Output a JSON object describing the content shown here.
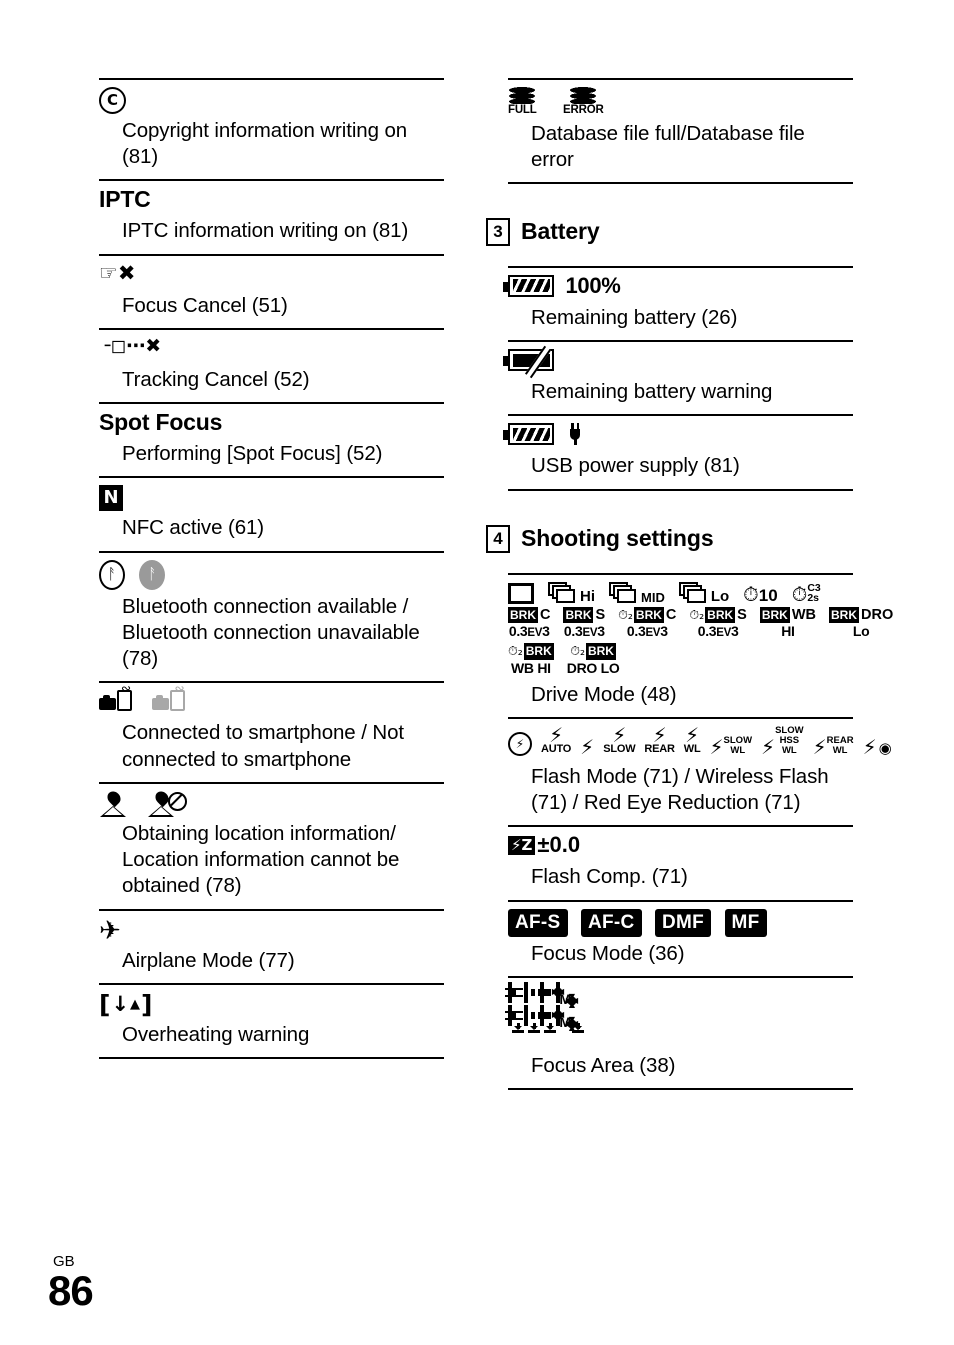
{
  "page": {
    "language_code": "GB",
    "page_number": "86"
  },
  "left_column": {
    "entries": [
      {
        "symbol_kind": "copyright-circle",
        "symbol_text": "C",
        "description": "Copyright information writing on (81)"
      },
      {
        "symbol_kind": "word",
        "symbol_text": "IPTC",
        "description": "IPTC information writing on (81)"
      },
      {
        "symbol_kind": "hand-cancel",
        "symbol_text": "☛✕",
        "description": "Focus Cancel (51)"
      },
      {
        "symbol_kind": "tracking-cancel",
        "symbol_text": "l▢⋟✕",
        "description": "Tracking Cancel (52)"
      },
      {
        "symbol_kind": "word",
        "symbol_text": "Spot Focus",
        "description": "Performing [Spot Focus] (52)"
      },
      {
        "symbol_kind": "nfc",
        "symbol_text": "N",
        "description": "NFC active (61)"
      },
      {
        "symbol_kind": "bluetooth-pair",
        "symbol_text": "ᛒ ᛒ",
        "description": "Bluetooth connection available / Bluetooth connection unavailable (78)"
      },
      {
        "symbol_kind": "smartphone-pair",
        "symbol_text": "camera-phone",
        "description": "Connected to smartphone / Not connected to smartphone"
      },
      {
        "symbol_kind": "location-pair",
        "symbol_text": "location-pin",
        "description": "Obtaining location information/ Location information cannot be obtained (78)"
      },
      {
        "symbol_kind": "airplane",
        "symbol_text": "✈",
        "description": "Airplane Mode (77)"
      },
      {
        "symbol_kind": "overheat",
        "symbol_text": "[!▲]",
        "description": "Overheating warning"
      }
    ]
  },
  "right_column": {
    "database_entry": {
      "symbol_kind": "database-stack",
      "label_full": "FULL",
      "label_error": "ERROR",
      "description": "Database file full/Database file error"
    },
    "sections": [
      {
        "number": "3",
        "title": "Battery",
        "entries": [
          {
            "symbol_kind": "battery-full",
            "symbol_text": "100%",
            "description": "Remaining battery (26)"
          },
          {
            "symbol_kind": "battery-warning",
            "symbol_text": "",
            "description": "Remaining battery warning"
          },
          {
            "symbol_kind": "battery-usb",
            "symbol_text": "",
            "description": "USB power supply (81)"
          }
        ]
      },
      {
        "number": "4",
        "title": "Shooting settings",
        "entries": [
          {
            "symbol_kind": "drive-mode",
            "description": "Drive Mode (48)",
            "drive_row1": [
              {
                "icon": "single-frame",
                "label": ""
              },
              {
                "icon": "burst",
                "label": "Hi"
              },
              {
                "icon": "burst",
                "label": "MID"
              },
              {
                "icon": "burst",
                "label": "Lo"
              },
              {
                "icon": "self-timer",
                "label": "10"
              },
              {
                "icon": "self-timer-cont",
                "label_top": "C3",
                "label_bottom": "2s"
              }
            ],
            "bracket_cells": [
              {
                "prefix": "",
                "brk": "BRK",
                "suffix": "C",
                "bottom": "0.3",
                "bottom_unit": "EV",
                "bottom_post": "3"
              },
              {
                "prefix": "",
                "brk": "BRK",
                "suffix": "S",
                "bottom": "0.3",
                "bottom_unit": "EV",
                "bottom_post": "3"
              },
              {
                "prefix": "timer2",
                "brk": "BRK",
                "suffix": "C",
                "bottom": "0.3",
                "bottom_unit": "EV",
                "bottom_post": "3"
              },
              {
                "prefix": "timer2",
                "brk": "BRK",
                "suffix": "S",
                "bottom": "0.3",
                "bottom_unit": "EV",
                "bottom_post": "3"
              },
              {
                "prefix": "",
                "brk": "BRK",
                "suffix": "WB",
                "bottom": "HI",
                "bottom_unit": "",
                "bottom_post": ""
              },
              {
                "prefix": "",
                "brk": "BRK",
                "suffix": "DRO",
                "bottom": "Lo",
                "bottom_unit": "",
                "bottom_post": ""
              }
            ],
            "bracket_cells_row2": [
              {
                "prefix": "timer2",
                "brk": "BRK",
                "suffix": "",
                "bottom": "WB HI",
                "bottom_unit": "",
                "bottom_post": ""
              },
              {
                "prefix": "timer2",
                "brk": "BRK",
                "suffix": "",
                "bottom": "DRO LO",
                "bottom_unit": "",
                "bottom_post": ""
              }
            ]
          },
          {
            "symbol_kind": "flash-modes",
            "description": "Flash Mode (71) / Wireless Flash (71) / Red Eye Reduction (71)",
            "flash_icons": [
              {
                "type": "no-flash",
                "label": ""
              },
              {
                "type": "bolt",
                "label": "AUTO"
              },
              {
                "type": "bolt",
                "label": ""
              },
              {
                "type": "bolt",
                "label": "SLOW"
              },
              {
                "type": "bolt",
                "label": "REAR"
              },
              {
                "type": "bolt",
                "label": "WL"
              },
              {
                "type": "bolt",
                "label_top": "SLOW",
                "label_bottom": "WL"
              },
              {
                "type": "bolt",
                "label_top": "SLOW",
                "label_mid": "HSS",
                "label_bottom": "WL"
              },
              {
                "type": "bolt",
                "label_top": "REAR",
                "label_bottom": "WL"
              },
              {
                "type": "bolt-eye",
                "label": ""
              }
            ]
          },
          {
            "symbol_kind": "flash-comp",
            "symbol_text": "±0.0",
            "description": "Flash Comp. (71)"
          },
          {
            "symbol_kind": "focus-mode",
            "description": "Focus Mode (36)",
            "badges": [
              "AF-S",
              "AF-C",
              "DMF",
              "MF"
            ]
          },
          {
            "symbol_kind": "focus-area",
            "description": "Focus Area (38)",
            "area_row1": [
              "wide",
              "zone",
              "center",
              "flexible-spot-M",
              "expand-flexible-spot"
            ],
            "area_row2": [
              "wide-tracking",
              "zone-tracking",
              "center-tracking",
              "flexible-spot-M-tracking",
              "expand-flexible-spot-tracking"
            ]
          }
        ]
      }
    ]
  }
}
